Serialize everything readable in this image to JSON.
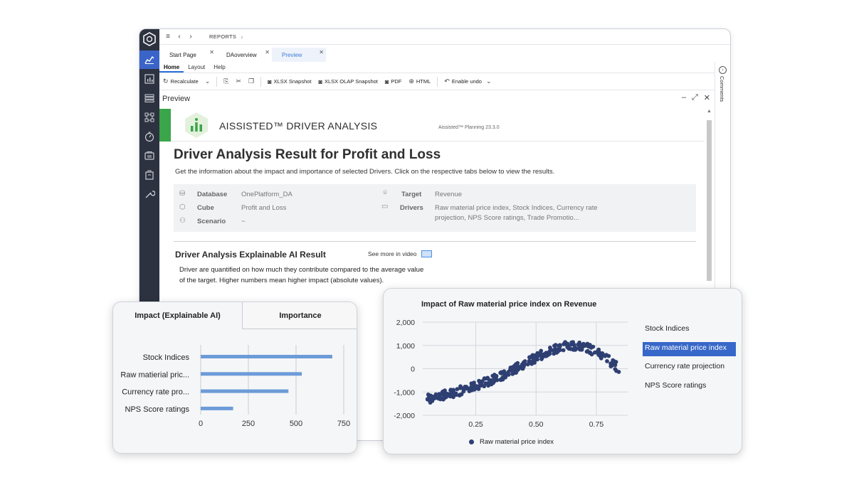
{
  "topbar": {
    "breadcrumb": "REPORTS"
  },
  "tabs": [
    {
      "label": "Start Page"
    },
    {
      "label": "DAoverview"
    },
    {
      "label": "Preview"
    }
  ],
  "ribbon_tabs": [
    "Home",
    "Layout",
    "Help"
  ],
  "toolbar": {
    "recalculate": "Recalculate",
    "xlsx_snapshot": "XLSX Snapshot",
    "xlsx_olap_snapshot": "XLSX OLAP Snapshot",
    "pdf": "PDF",
    "html": "HTML",
    "enable_undo": "Enable undo"
  },
  "right_panel": {
    "label": "Comments"
  },
  "preview": {
    "title": "Preview"
  },
  "banner": {
    "title": "AISSISTED™ DRIVER ANALYSIS",
    "version": "Aissisted™ Planning 23.3.0",
    "accent": "#3aa54a"
  },
  "report": {
    "heading": "Driver Analysis Result for Profit and Loss",
    "intro": "Get the information about the impact and importance of selected Drivers. Click on the respective tabs below to view the results.",
    "info": {
      "database_label": "Database",
      "database_value": "OnePlatform_DA",
      "cube_label": "Cube",
      "cube_value": "Profit and Loss",
      "scenario_label": "Scenario",
      "scenario_value": "~",
      "target_label": "Target",
      "target_value": "Revenue",
      "drivers_label": "Drivers",
      "drivers_value_line1": "Raw material price index, Stock Indices, Currency rate",
      "drivers_value_line2": "projection, NPS Score ratings, Trade Promotio..."
    },
    "section_heading": "Driver Analysis Explainable AI Result",
    "video_link": "See more in video",
    "description_line1": "Driver are quantified on how much they contribute compared to the average value",
    "description_line2": "of the target. Higher numbers mean higher impact (absolute values)."
  },
  "impact_card": {
    "tab_active": "Impact (Explainable AI)",
    "tab_inactive": "Importance"
  },
  "scatter_card": {
    "legend": [
      "Stock Indices",
      "Raw material price index",
      "Currency rate projection",
      "NPS Score ratings"
    ],
    "selected_legend": "Raw material price index",
    "series_legend": "Raw material price index",
    "accent": "#3767c8"
  },
  "chart_data": [
    {
      "type": "bar",
      "orientation": "horizontal",
      "categories": [
        "Stock Indices",
        "Raw matierial pric...",
        "Currency rate pro...",
        "NPS Score ratings"
      ],
      "values": [
        690,
        530,
        460,
        170
      ],
      "xlim": [
        0,
        750
      ],
      "xticks": [
        0,
        250,
        500,
        750
      ],
      "grid": true,
      "color": "#6c9bd8"
    },
    {
      "type": "scatter",
      "title": "Impact of Raw material price index on Revenue",
      "series": [
        {
          "name": "Raw material price index",
          "color": "#2e3f72"
        }
      ],
      "xlabel": "",
      "ylabel": "",
      "xlim": [
        0.03,
        0.88
      ],
      "ylim": [
        -2000,
        2000
      ],
      "xticks": [
        0.25,
        0.5,
        0.75
      ],
      "xtick_labels": [
        "0.25",
        "0.50",
        "0.75"
      ],
      "yticks": [
        2000,
        1000,
        0,
        -1000,
        -2000
      ],
      "ytick_labels": [
        "2,000",
        "1,000",
        "0",
        "-1,000",
        "-2,000"
      ],
      "grid": true,
      "legend_position": "bottom",
      "trend": {
        "x": [
          0.05,
          0.15,
          0.25,
          0.35,
          0.45,
          0.55,
          0.62,
          0.7,
          0.78,
          0.85
        ],
        "y": [
          -1300,
          -1050,
          -750,
          -350,
          200,
          750,
          1000,
          950,
          550,
          -50
        ]
      }
    }
  ]
}
